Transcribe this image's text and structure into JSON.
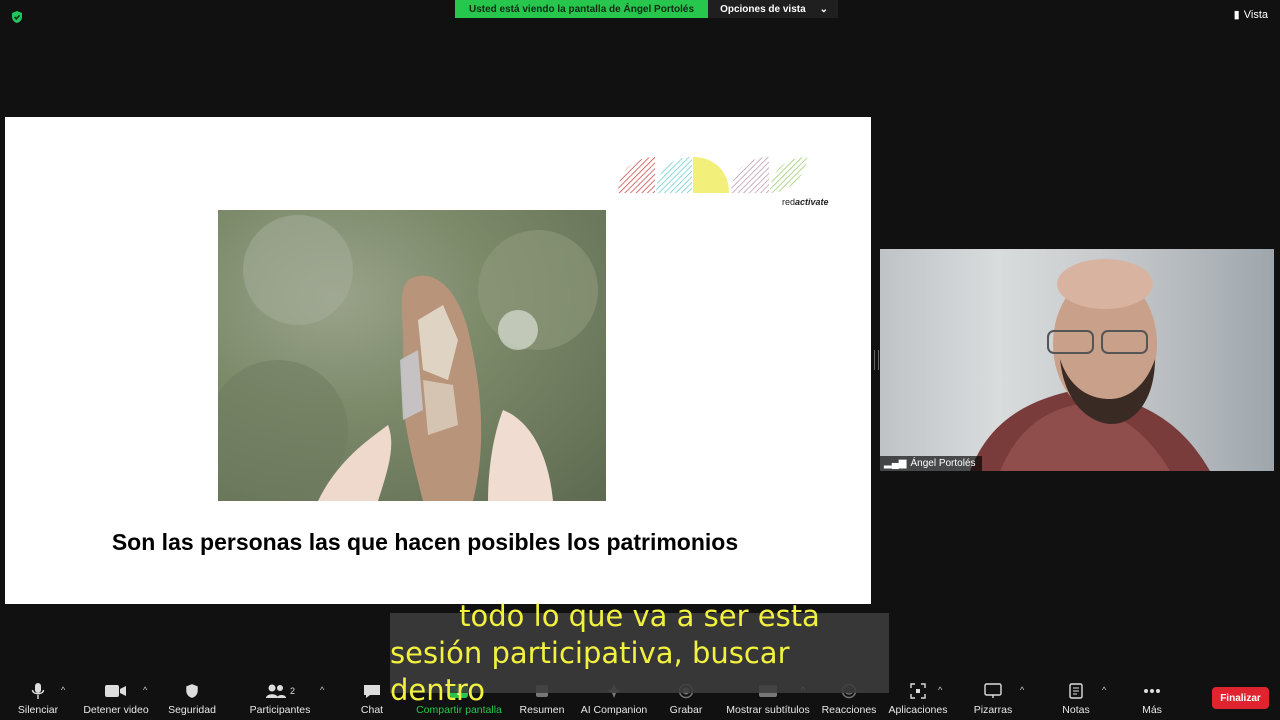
{
  "top": {
    "sharing_notice": "Usted está viendo la pantalla de Ángel Portolés",
    "view_options": "Opciones de vista",
    "view_button": "Vista"
  },
  "slide": {
    "logo_prefix": "red",
    "logo_bold": "activate",
    "caption": "Son las personas las que hacen posibles los patrimonios"
  },
  "participant": {
    "name": "Ángel Portolés"
  },
  "subtitles": {
    "line1": "todo lo que va a ser esta",
    "line2": "sesión participativa, buscar dentro"
  },
  "toolbar": {
    "mute": "Silenciar",
    "stop_video": "Detener video",
    "security": "Seguridad",
    "participants": "Participantes",
    "participants_count": "2",
    "chat": "Chat",
    "share_screen": "Compartir pantalla",
    "summary": "Resumen",
    "ai_companion": "AI Companion",
    "record": "Grabar",
    "show_captions": "Mostrar subtítulos",
    "reactions": "Reacciones",
    "apps": "Aplicaciones",
    "whiteboards": "Pizarras",
    "notes": "Notas",
    "more": "Más",
    "end": "Finalizar"
  },
  "colors": {
    "share_green": "#26c74c",
    "end_red": "#e0242f",
    "caption_yellow": "#f3f140"
  }
}
